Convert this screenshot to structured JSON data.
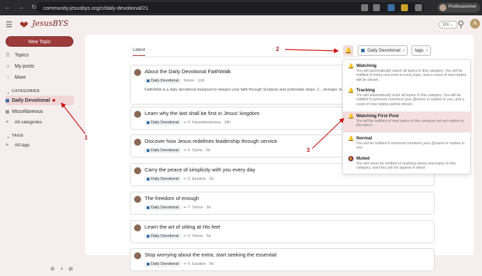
{
  "browser": {
    "nav_icons": "← → ↻",
    "url": "community.jesusbys.org/c/daily-devotional/21",
    "profile": "Professionnel"
  },
  "header": {
    "logo": "JesusBYS",
    "lang": "EN ⌄",
    "avatar_letter": "A"
  },
  "sidebar": {
    "new_topic": "New Topic",
    "items": [
      {
        "label": "Topics",
        "icon": "☰"
      },
      {
        "label": "My posts",
        "icon": "☺"
      },
      {
        "label": "More",
        "icon": "⋮"
      }
    ],
    "categories_heading": "CATEGORIES",
    "categories": [
      {
        "label": "Daily Devotional",
        "color": "#3b6ea5"
      },
      {
        "label": "Miscellaneous",
        "color": "#999999"
      },
      {
        "label": "All categories"
      }
    ],
    "tags_heading": "TAGS",
    "tags": [
      {
        "label": "All tags"
      }
    ],
    "bottom": "⚙ + ⊞"
  },
  "toolbar": {
    "tab_latest": "Latest",
    "category_dropdown": "Daily Devotional",
    "tags_dropdown": "tags"
  },
  "topics": [
    {
      "title": "About the Daily Devotional FaithWalk",
      "category": "Daily Devotional",
      "replies": "",
      "author": "Simon",
      "age": "10d",
      "excerpt": "FaithWalk is a daily devotional designed to deepen your faith through Scripture and actionable steps. J... stronger, together."
    },
    {
      "title": "Learn why the last shall be first in Jesus' kingdom",
      "category": "Daily Devotional",
      "replies": "4",
      "author": "Fanombinantsoa",
      "age": "18h"
    },
    {
      "title": "Discover how Jesus redefines leadership through service",
      "category": "Daily Devotional",
      "replies": "5",
      "author": "Sylvia",
      "age": "2d"
    },
    {
      "title": "Carry the peace of simplicity with you every day",
      "category": "Daily Devotional",
      "replies": "3",
      "author": "Ejustine",
      "age": "2d"
    },
    {
      "title": "The freedom of enough",
      "category": "Daily Devotional",
      "replies": "7",
      "author": "Simon",
      "age": "3d"
    },
    {
      "title": "Learn the art of sitting at His feet",
      "category": "Daily Devotional",
      "replies": "5",
      "author": "Simon",
      "age": "5d"
    },
    {
      "title": "Stop worrying about the extra; start seeking the essential",
      "category": "Daily Devotional",
      "replies": "5",
      "author": "Ejustine",
      "age": "5d"
    }
  ],
  "notification_menu": [
    {
      "title": "Watching",
      "icon": "🔔",
      "desc": "You will automatically watch all topics in this category. You will be notified of every new post in every topic, and a count of new replies will be shown."
    },
    {
      "title": "Tracking",
      "icon": "🔔",
      "desc": "You will automatically track all topics in this category. You will be notified if someone mentions your @name or replies to you, and a count of new replies will be shown."
    },
    {
      "title": "Watching First Post",
      "icon": "🔔",
      "desc": "You will be notified of new topics in this category but not replies to the topics.",
      "selected": true
    },
    {
      "title": "Normal",
      "icon": "🔔",
      "desc": "You will be notified if someone mentions your @name or replies to you."
    },
    {
      "title": "Muted",
      "icon": "🔕",
      "desc": "You will never be notified of anything about new topics in this category, and they will not appear in latest."
    }
  ],
  "annotations": [
    "1",
    "2",
    "3"
  ],
  "colors": {
    "accent": "#9c3b3b",
    "annotation": "#cc1111",
    "category": "#3b6ea5"
  }
}
